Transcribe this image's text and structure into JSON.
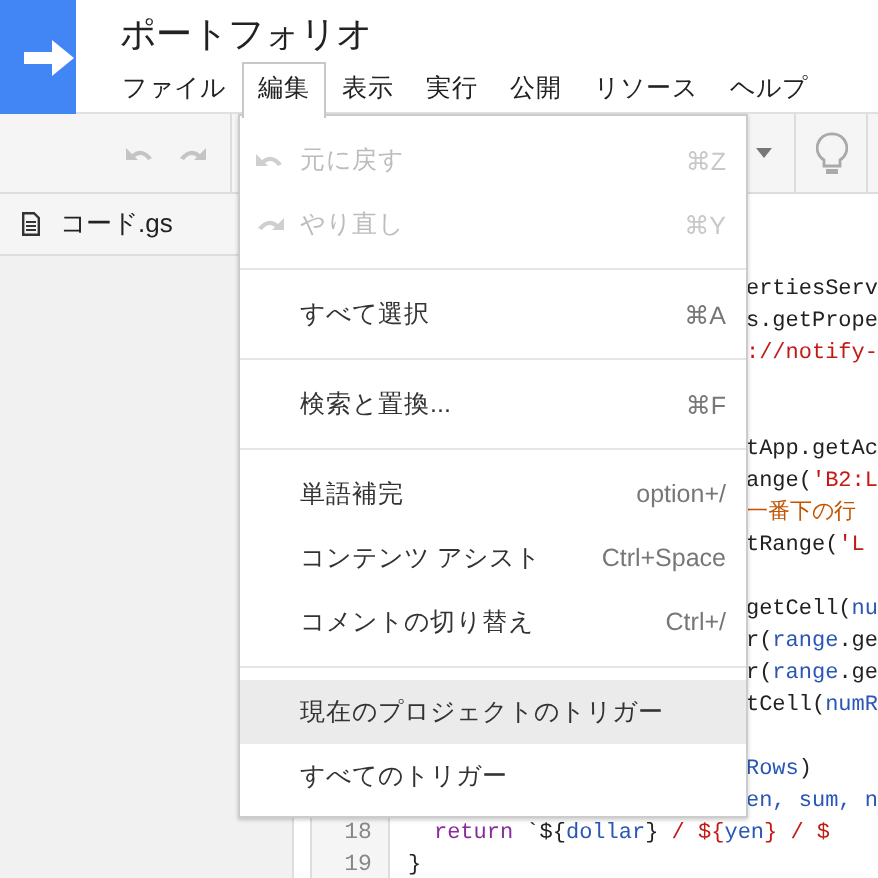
{
  "title": "ポートフォリオ",
  "menubar": [
    {
      "label": "ファイル",
      "selected": false
    },
    {
      "label": "編集",
      "selected": true
    },
    {
      "label": "表示",
      "selected": false
    },
    {
      "label": "実行",
      "selected": false
    },
    {
      "label": "公開",
      "selected": false
    },
    {
      "label": "リソース",
      "selected": false
    },
    {
      "label": "ヘルプ",
      "selected": false
    }
  ],
  "files": [
    {
      "name": "コード.gs"
    }
  ],
  "editor": {
    "lines": [
      {
        "kind": "covered",
        "code": [
          {
            "kind": "plain",
            "text": "ertiesServ"
          }
        ]
      },
      {
        "kind": "covered",
        "code": [
          {
            "kind": "plain",
            "text": "s.getPrope"
          }
        ]
      },
      {
        "kind": "covered",
        "code": [
          {
            "kind": "string",
            "text": "://notify-"
          }
        ]
      },
      {
        "kind": "blank"
      },
      {
        "kind": "blank"
      },
      {
        "kind": "covered",
        "code": [
          {
            "kind": "plain",
            "text": "tApp.getAc"
          }
        ]
      },
      {
        "kind": "covered",
        "code": [
          {
            "kind": "plain",
            "text": "ange("
          },
          {
            "kind": "string",
            "text": "'B2:L"
          }
        ]
      },
      {
        "kind": "covered",
        "code": [
          {
            "kind": "comment",
            "text": "一番下の行"
          }
        ]
      },
      {
        "kind": "covered",
        "code": [
          {
            "kind": "plain",
            "text": "tRange("
          },
          {
            "kind": "string",
            "text": "'L"
          }
        ]
      },
      {
        "kind": "blank"
      },
      {
        "kind": "covered",
        "code": [
          {
            "kind": "plain",
            "text": "getCell("
          },
          {
            "kind": "variable",
            "text": "nu"
          }
        ]
      },
      {
        "kind": "covered",
        "code": [
          {
            "kind": "plain",
            "text": "r("
          },
          {
            "kind": "variable",
            "text": "range"
          },
          {
            "kind": "plain",
            "text": ".ge"
          }
        ]
      },
      {
        "kind": "covered",
        "code": [
          {
            "kind": "plain",
            "text": "r("
          },
          {
            "kind": "variable",
            "text": "range"
          },
          {
            "kind": "plain",
            "text": ".ge"
          }
        ]
      },
      {
        "kind": "covered",
        "code": [
          {
            "kind": "plain",
            "text": "tCell("
          },
          {
            "kind": "variable",
            "text": "numR"
          }
        ]
      },
      {
        "kind": "blank"
      },
      {
        "kind": "covered",
        "code": [
          {
            "kind": "variable",
            "text": "Rows"
          },
          {
            "kind": "plain",
            "text": ")"
          }
        ]
      },
      {
        "kind": "covered",
        "code": [
          {
            "kind": "variable",
            "text": "en, sum, n"
          }
        ]
      },
      {
        "kind": "full",
        "number": "18",
        "indented": true,
        "code": [
          {
            "kind": "keyword",
            "text": "return"
          },
          {
            "kind": "plain",
            "text": " `${"
          },
          {
            "kind": "variable",
            "text": "dollar"
          },
          {
            "kind": "plain",
            "text": "}"
          },
          {
            "kind": "string",
            "text": " / ${"
          },
          {
            "kind": "variable",
            "text": "yen"
          },
          {
            "kind": "string",
            "text": "} / $"
          }
        ]
      },
      {
        "kind": "full",
        "number": "19",
        "indented": false,
        "code": [
          {
            "kind": "plain",
            "text": "}"
          }
        ]
      }
    ]
  },
  "edit_menu": [
    {
      "kind": "undo",
      "label": "元に戻す",
      "shortcut": "⌘Z",
      "disabled": true,
      "selected": false
    },
    {
      "kind": "redo",
      "label": "やり直し",
      "shortcut": "⌘Y",
      "disabled": true,
      "selected": false
    },
    {
      "kind": "separator"
    },
    {
      "kind": "item",
      "label": "すべて選択",
      "shortcut": "⌘A",
      "disabled": false,
      "selected": false
    },
    {
      "kind": "separator"
    },
    {
      "kind": "item",
      "label": "検索と置換...",
      "shortcut": "⌘F",
      "disabled": false,
      "selected": false
    },
    {
      "kind": "separator"
    },
    {
      "kind": "item",
      "label": "単語補完",
      "shortcut": "option+/",
      "disabled": false,
      "selected": false
    },
    {
      "kind": "item",
      "label": "コンテンツ アシスト",
      "shortcut": "Ctrl+Space",
      "disabled": false,
      "selected": false
    },
    {
      "kind": "item",
      "label": "コメントの切り替え",
      "shortcut": "Ctrl+/",
      "disabled": false,
      "selected": false
    },
    {
      "kind": "separator"
    },
    {
      "kind": "item",
      "label": "現在のプロジェクトのトリガー",
      "disabled": false,
      "selected": true
    },
    {
      "kind": "item",
      "label": "すべてのトリガー",
      "disabled": false,
      "selected": false
    }
  ]
}
